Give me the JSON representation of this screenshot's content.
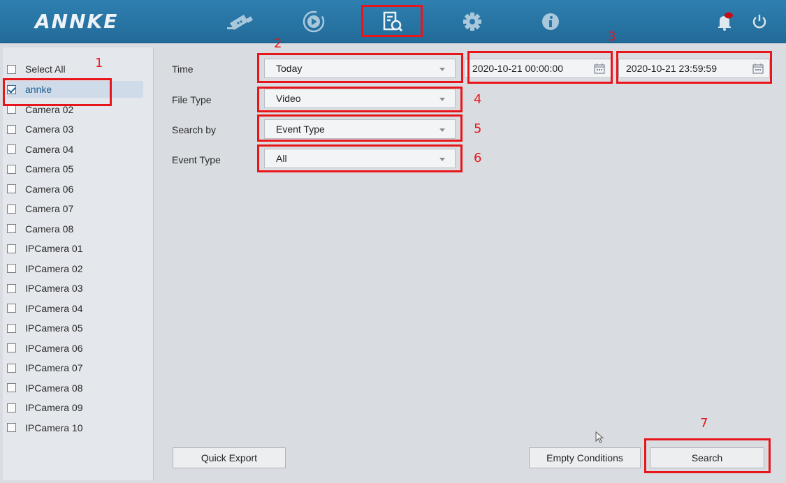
{
  "header": {
    "logo_text": "ANNKE",
    "nav_icons": [
      "camera-icon",
      "playback-icon",
      "file-search-icon",
      "gear-icon",
      "info-icon"
    ],
    "right_icons": [
      "bell-icon",
      "power-icon"
    ],
    "accent_color": "#2a78a8",
    "highlight_color": "#e8161b"
  },
  "sidebar": {
    "select_all": "Select All",
    "cameras": [
      {
        "label": "annke",
        "checked": true
      },
      {
        "label": "Camera 02",
        "checked": false
      },
      {
        "label": "Camera 03",
        "checked": false
      },
      {
        "label": "Camera 04",
        "checked": false
      },
      {
        "label": "Camera 05",
        "checked": false
      },
      {
        "label": "Camera 06",
        "checked": false
      },
      {
        "label": "Camera 07",
        "checked": false
      },
      {
        "label": "Camera 08",
        "checked": false
      },
      {
        "label": "IPCamera 01",
        "checked": false
      },
      {
        "label": "IPCamera 02",
        "checked": false
      },
      {
        "label": "IPCamera 03",
        "checked": false
      },
      {
        "label": "IPCamera 04",
        "checked": false
      },
      {
        "label": "IPCamera 05",
        "checked": false
      },
      {
        "label": "IPCamera 06",
        "checked": false
      },
      {
        "label": "IPCamera 07",
        "checked": false
      },
      {
        "label": "IPCamera 08",
        "checked": false
      },
      {
        "label": "IPCamera 09",
        "checked": false
      },
      {
        "label": "IPCamera 10",
        "checked": false
      }
    ]
  },
  "form": {
    "time": {
      "label": "Time",
      "value": "Today",
      "start": "2020-10-21 00:00:00",
      "end": "2020-10-21 23:59:59"
    },
    "file_type": {
      "label": "File Type",
      "value": "Video"
    },
    "search_by": {
      "label": "Search by",
      "value": "Event Type"
    },
    "event_type": {
      "label": "Event Type",
      "value": "All"
    }
  },
  "buttons": {
    "quick_export": "Quick Export",
    "empty_conditions": "Empty Conditions",
    "search": "Search"
  },
  "annotations": [
    "1",
    "2",
    "3",
    "4",
    "5",
    "6",
    "7"
  ]
}
